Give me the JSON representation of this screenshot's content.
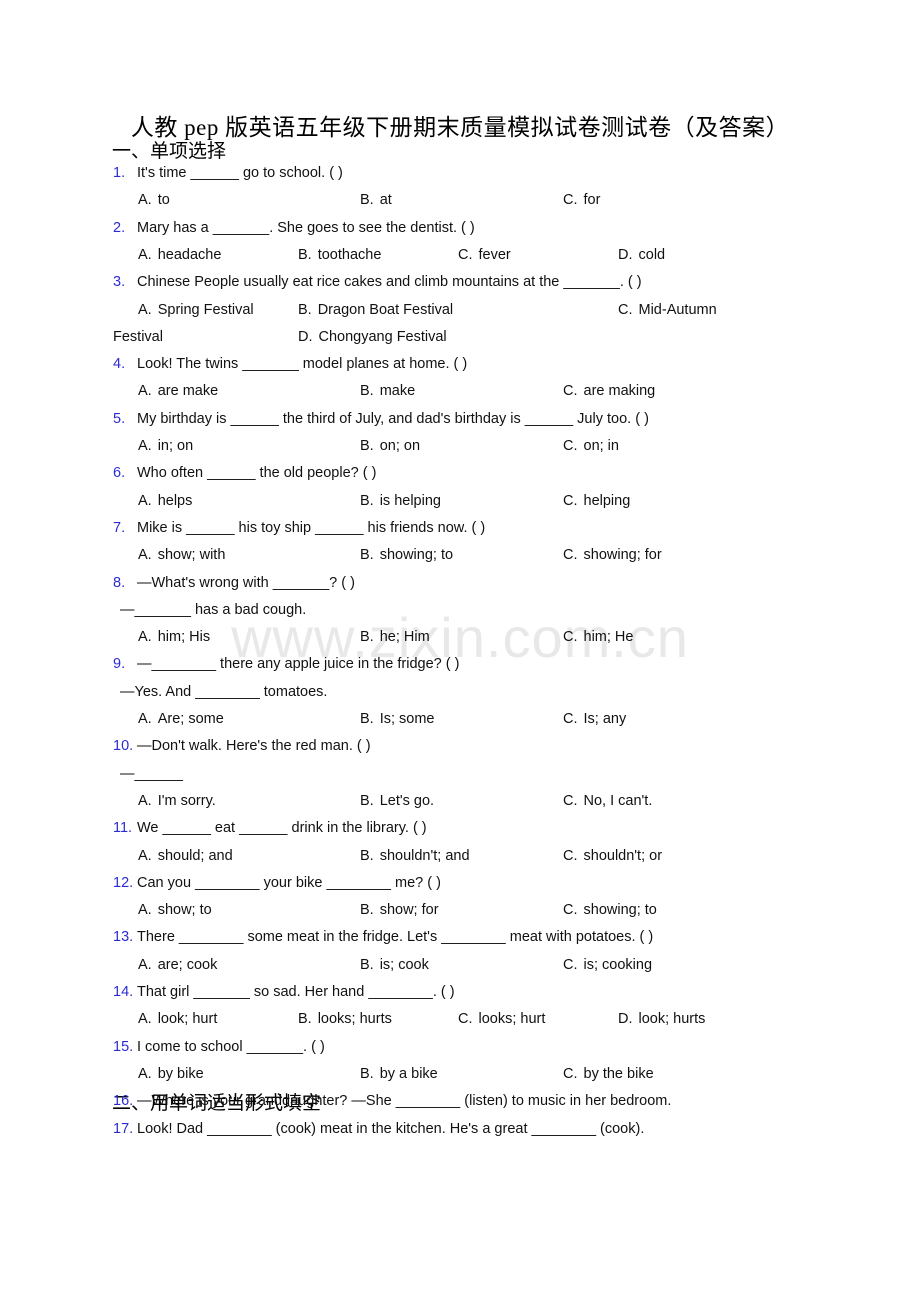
{
  "document": {
    "title": "人教 pep 版英语五年级下册期末质量模拟试卷测试卷（及答案）",
    "watermark": "www.zixin.com.cn"
  },
  "sections": [
    {
      "id": "section-1",
      "heading": "一、单项选择"
    },
    {
      "id": "section-2",
      "heading": "二、用单词适当形式填空"
    }
  ],
  "questions": [
    {
      "num": "1.",
      "text": "It's time ______ go to school. (   )",
      "layout": "three",
      "options": [
        {
          "letter": "A.",
          "text": "to"
        },
        {
          "letter": "B.",
          "text": "at"
        },
        {
          "letter": "C.",
          "text": "for"
        }
      ]
    },
    {
      "num": "2.",
      "text": "Mary has a _______. She goes to see the dentist. (  )",
      "layout": "four",
      "options": [
        {
          "letter": "A.",
          "text": "headache"
        },
        {
          "letter": "B.",
          "text": "toothache"
        },
        {
          "letter": "C.",
          "text": "fever"
        },
        {
          "letter": "D.",
          "text": "cold"
        }
      ]
    },
    {
      "num": "3.",
      "text": "Chinese People usually eat rice cakes and climb mountains at the _______. (  )",
      "layout": "wrap34",
      "options": [
        {
          "letter": "A.",
          "text": "Spring Festival"
        },
        {
          "letter": "B.",
          "text": "Dragon Boat Festival"
        },
        {
          "letter": "C.",
          "text": "Mid-Autumn"
        },
        {
          "letter": "",
          "text": "Festival"
        },
        {
          "letter": "D.",
          "text": "Chongyang Festival"
        }
      ]
    },
    {
      "num": "4.",
      "text": "Look! The twins _______ model planes at home. (  )",
      "layout": "three",
      "options": [
        {
          "letter": "A.",
          "text": "are make"
        },
        {
          "letter": "B.",
          "text": "make"
        },
        {
          "letter": "C.",
          "text": "are making"
        }
      ]
    },
    {
      "num": "5.",
      "text": "My birthday is ______ the third of July, and dad's birthday is ______ July too. (  )",
      "layout": "three",
      "options": [
        {
          "letter": "A.",
          "text": "in; on"
        },
        {
          "letter": "B.",
          "text": "on; on"
        },
        {
          "letter": "C.",
          "text": "on; in"
        }
      ]
    },
    {
      "num": "6.",
      "text": "Who often ______ the old people? (  )",
      "layout": "three",
      "options": [
        {
          "letter": "A.",
          "text": "helps"
        },
        {
          "letter": "B.",
          "text": "is helping"
        },
        {
          "letter": "C.",
          "text": "helping"
        }
      ]
    },
    {
      "num": "7.",
      "text": "Mike is ______ his toy ship ______ his friends now. (  )",
      "layout": "three",
      "options": [
        {
          "letter": "A.",
          "text": "show; with"
        },
        {
          "letter": "B.",
          "text": "showing; to"
        },
        {
          "letter": "C.",
          "text": "showing; for"
        }
      ]
    },
    {
      "num": "8.",
      "text": "—What's wrong with _______? (   )",
      "text2": "—_______ has a bad cough.",
      "layout": "three",
      "options": [
        {
          "letter": "A.",
          "text": "him; His"
        },
        {
          "letter": "B.",
          "text": "he; Him"
        },
        {
          "letter": "C.",
          "text": "him; He"
        }
      ]
    },
    {
      "num": "9.",
      "text": "—________ there any apple juice in the fridge? (    )",
      "text2": "—Yes. And ________ tomatoes.",
      "layout": "three",
      "options": [
        {
          "letter": "A.",
          "text": "Are; some"
        },
        {
          "letter": "B.",
          "text": "Is; some"
        },
        {
          "letter": "C.",
          "text": "Is; any"
        }
      ]
    },
    {
      "num": "10.",
      "text": "—Don't walk. Here's the red man. (  )",
      "text2": "—______",
      "layout": "three",
      "options": [
        {
          "letter": "A.",
          "text": "I'm sorry."
        },
        {
          "letter": "B.",
          "text": "Let's go."
        },
        {
          "letter": "C.",
          "text": "No, I can't."
        }
      ]
    },
    {
      "num": "11.",
      "text": "We ______ eat ______ drink in the library. (  )",
      "layout": "three",
      "options": [
        {
          "letter": "A.",
          "text": "should; and"
        },
        {
          "letter": "B.",
          "text": "shouldn't; and"
        },
        {
          "letter": "C.",
          "text": "shouldn't; or"
        }
      ]
    },
    {
      "num": "12.",
      "text": "Can you ________ your bike ________ me? (   )",
      "layout": "three",
      "options": [
        {
          "letter": "A.",
          "text": "show; to"
        },
        {
          "letter": "B.",
          "text": "show; for"
        },
        {
          "letter": "C.",
          "text": "showing; to"
        }
      ]
    },
    {
      "num": "13.",
      "text": "There ________ some meat in the fridge. Let's ________ meat with potatoes. (   )",
      "layout": "three",
      "options": [
        {
          "letter": "A.",
          "text": "are; cook"
        },
        {
          "letter": "B.",
          "text": "is; cook"
        },
        {
          "letter": "C.",
          "text": "is; cooking"
        }
      ]
    },
    {
      "num": "14.",
      "text": "That girl _______ so sad. Her hand ________. (  )",
      "layout": "four",
      "options": [
        {
          "letter": "A.",
          "text": "look; hurt"
        },
        {
          "letter": "B.",
          "text": "looks; hurts"
        },
        {
          "letter": "C.",
          "text": "looks; hurt"
        },
        {
          "letter": "D.",
          "text": "look; hurts"
        }
      ]
    },
    {
      "num": "15.",
      "text": "I come to school _______. (  )",
      "layout": "three",
      "options": [
        {
          "letter": "A.",
          "text": "by bike"
        },
        {
          "letter": "B.",
          "text": "by a bike"
        },
        {
          "letter": "C.",
          "text": "by the bike"
        }
      ]
    },
    {
      "num": "16.",
      "text": "—Where is your granddaughter?  —She ________ (listen) to music in her bedroom.",
      "layout": "none",
      "options": []
    },
    {
      "num": "17.",
      "text": "Look! Dad ________ (cook) meat in the kitchen. He's a great ________ (cook).",
      "layout": "none",
      "options": []
    }
  ]
}
